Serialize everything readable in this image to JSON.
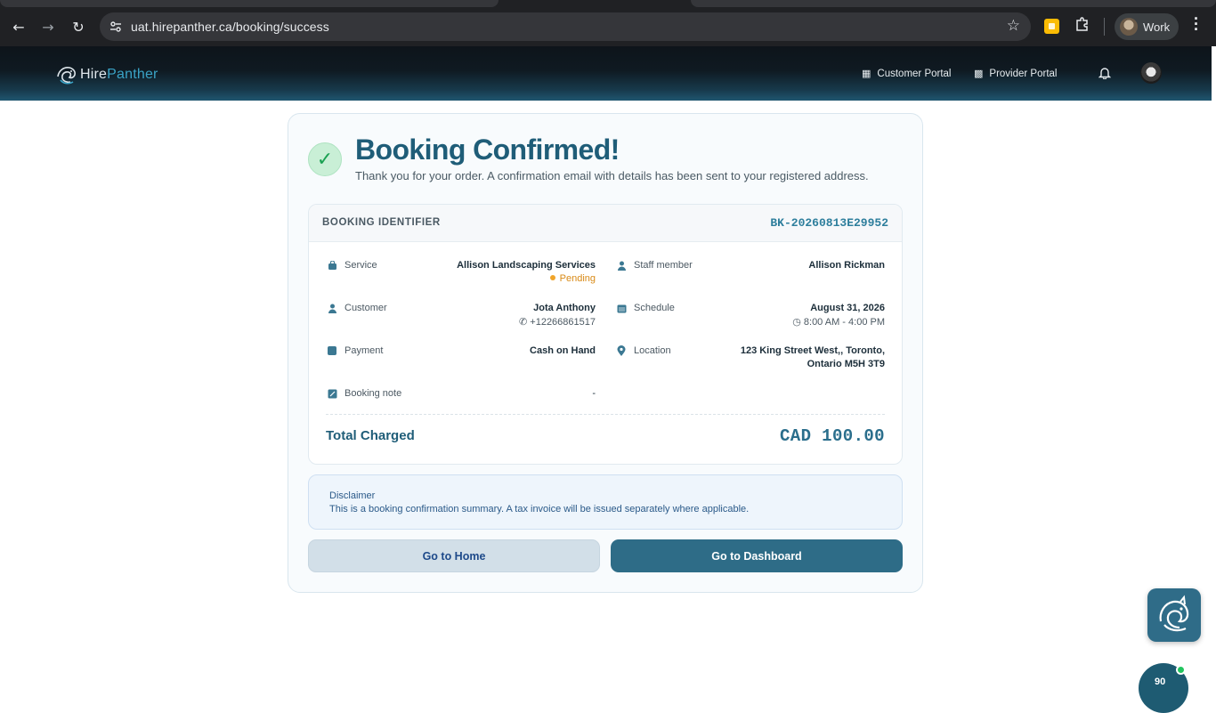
{
  "browser": {
    "url": "uat.hirepanther.ca/booking/success",
    "profile_label": "Work",
    "icons": [
      "back-icon",
      "forward-icon",
      "reload-icon",
      "site-settings-icon",
      "bookmark-star-icon",
      "extension-icon",
      "puzzle-icon",
      "menu-kebab-icon"
    ]
  },
  "header": {
    "logo_part1": "Hire",
    "logo_part2": "Panther",
    "nav": [
      {
        "label": "Customer Portal",
        "icon": "grid-icon"
      },
      {
        "label": "Provider Portal",
        "icon": "grid-outline-icon"
      }
    ]
  },
  "confirmation": {
    "title": "Booking Confirmed!",
    "subtitle": "Thank you for your order. A confirmation email with details has been sent to your registered address.",
    "identifier_label": "BOOKING IDENTIFIER",
    "identifier_value": "BK-20260813E29952"
  },
  "details": {
    "service": {
      "label": "Service",
      "value": "Allison Landscaping Services",
      "status": "Pending"
    },
    "staff": {
      "label": "Staff member",
      "value": "Allison Rickman"
    },
    "customer": {
      "label": "Customer",
      "value": "Jota Anthony",
      "phone": "+12266861517"
    },
    "schedule": {
      "label": "Schedule",
      "date": "August 31, 2026",
      "time": "8:00 AM - 4:00 PM"
    },
    "payment": {
      "label": "Payment",
      "value": "Cash on Hand"
    },
    "location": {
      "label": "Location",
      "line1": "123 King Street West,, Toronto,",
      "line2": "Ontario M5H 3T9"
    },
    "note": {
      "label": "Booking note",
      "value": "-"
    }
  },
  "total": {
    "label": "Total Charged",
    "value": "CAD 100.00"
  },
  "disclaimer": {
    "title": "Disclaimer",
    "text": "This is a booking confirmation summary. A tax invoice will be issued separately where applicable."
  },
  "actions": {
    "home": "Go to Home",
    "dashboard": "Go to Dashboard"
  },
  "widgets": {
    "peek_text": "90"
  },
  "colors": {
    "brand": "#2e6c87",
    "title": "#1f5d78",
    "success": "#1aa152",
    "pending": "#d98a16"
  }
}
